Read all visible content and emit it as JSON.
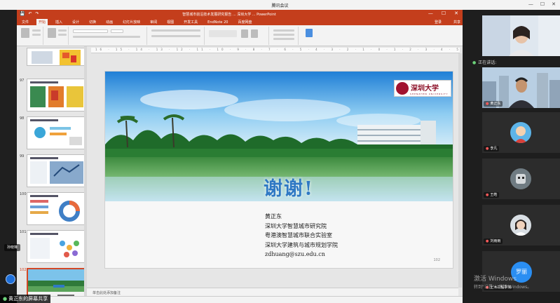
{
  "meeting": {
    "title": "腾讯会议",
    "controls": [
      "—",
      "☐",
      "✕"
    ]
  },
  "ppt": {
    "window_title": "智慧城市前沿技术发展研究报告 ... 深圳大学 ... PowerPoint",
    "quick_access": [
      "💾",
      "↶",
      "↷"
    ],
    "window_controls": [
      "—",
      "☐",
      "✕"
    ],
    "tabs": [
      "文件",
      "开始",
      "插入",
      "设计",
      "切换",
      "动画",
      "幻灯片放映",
      "审阅",
      "视图",
      "开发工具",
      "EndNote 20",
      "百度网盘"
    ],
    "active_tab": "开始",
    "account": "登录",
    "share": "共享",
    "ruler_text": "16 · 15 · 14 · 13 · 12 · 11 · 10 · 9 · 8 · 7 · 6 · 5 · 4 · 3 · 2 · 1 · 0 · 1 · 2 · 3 · 4 · 5 · 6 · 7 · 8 · 9 · 10 · 11 · 12 · 13 · 14 · 15 · 16",
    "notes_placeholder": "单击此处添加备注",
    "thumbnails": [
      {
        "num": "",
        "kind": "heatmap"
      },
      {
        "num": "97",
        "kind": "heatmap"
      },
      {
        "num": "98",
        "kind": "infographic"
      },
      {
        "num": "99",
        "kind": "map"
      },
      {
        "num": "100",
        "kind": "donut"
      },
      {
        "num": "101",
        "kind": "dots"
      },
      {
        "num": "102",
        "kind": "campus"
      }
    ],
    "current_slide": {
      "thanks": "谢谢!",
      "logo_cn": "深圳大学",
      "logo_en": "SHENZHEN UNIVERSITY",
      "info": [
        "黄正东",
        "深圳大学智慧城市研究院",
        "粤港澳智慧城市联合实验室",
        "深圳大学建筑与城市规划学院",
        "zdhuang@szu.edu.cn"
      ],
      "number": "102"
    }
  },
  "overlay": {
    "presenter_tag": "孙晓锋",
    "share_label": "黄正东的屏幕共享"
  },
  "participants": {
    "speaking_label": "正在讲话:",
    "tiles": [
      {
        "name": "",
        "kind": "video-woman"
      },
      {
        "name": "黄正东",
        "kind": "video-man"
      },
      {
        "name": "李凡",
        "kind": "avatar-cartoon"
      },
      {
        "name": "王皓",
        "kind": "avatar-robot"
      },
      {
        "name": "刘雨雨",
        "kind": "avatar-girl"
      },
      {
        "name": "土木工程学院",
        "kind": "avatar-text"
      }
    ],
    "luo_avatar": "罗丽"
  },
  "watermark": {
    "line1": "激活 Windows",
    "line2": "转到\"设置\"以激活 Windows。"
  },
  "colors": {
    "ppt_accent": "#c43e1c",
    "thanks_blue": "#2f79c4",
    "szu_red": "#8b0d25",
    "meeting_blue": "#2a8ef2"
  }
}
